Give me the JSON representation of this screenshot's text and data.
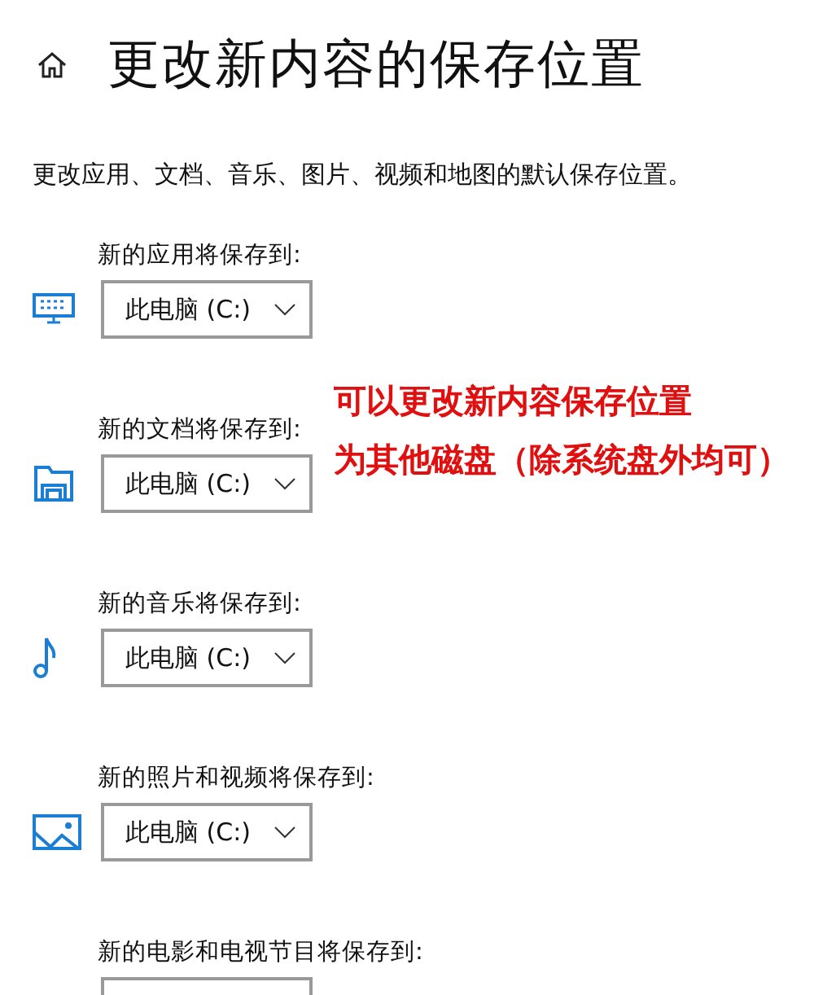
{
  "header": {
    "title": "更改新内容的保存位置"
  },
  "description": "更改应用、文档、音乐、图片、视频和地图的默认保存位置。",
  "locations": [
    {
      "label": "新的应用将保存到:",
      "kind": "apps",
      "value": "此电脑 (C:)"
    },
    {
      "label": "新的文档将保存到:",
      "kind": "documents",
      "value": "此电脑 (C:)"
    },
    {
      "label": "新的音乐将保存到:",
      "kind": "music",
      "value": "此电脑 (C:)"
    },
    {
      "label": "新的照片和视频将保存到:",
      "kind": "photos",
      "value": "此电脑 (C:)"
    },
    {
      "label": "新的电影和电视节目将保存到:",
      "kind": "movies"
    }
  ],
  "annotation": [
    "可以更改新内容保存位置",
    "为其他磁盘（除系统盘外均可）"
  ]
}
